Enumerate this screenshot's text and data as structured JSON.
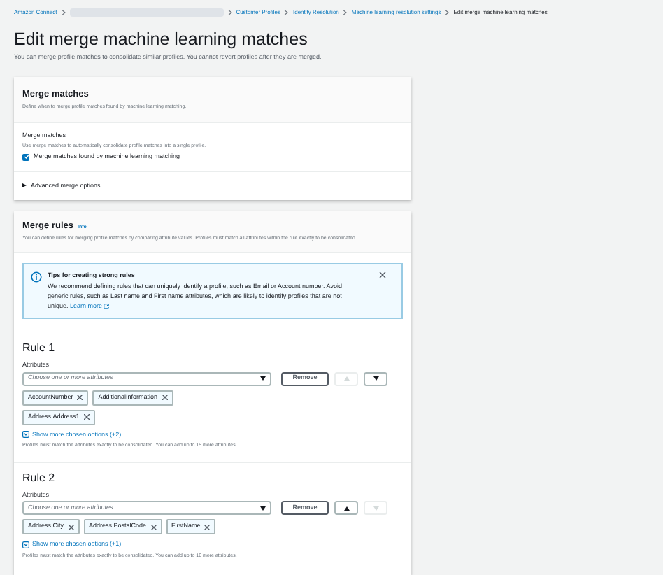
{
  "breadcrumbs": [
    {
      "label": "Amazon Connect",
      "current": false
    },
    {
      "kind": "redacted"
    },
    {
      "label": "Customer Profiles",
      "current": false
    },
    {
      "label": "Identity Resolution",
      "current": false
    },
    {
      "label": "Machine learning resolution settings",
      "current": false
    },
    {
      "label": "Edit merge machine learning matches",
      "current": true
    }
  ],
  "title": "Edit merge machine learning matches",
  "subtitle": "You can merge profile matches to consolidate similar profiles. You cannot revert profiles after they are merged.",
  "merge_matches": {
    "title": "Merge matches",
    "description": "Define when to merge profile matches found by machine learning matching.",
    "field_label": "Merge matches",
    "field_description": "Use merge matches to automatically consolidate profile matches into a single profile.",
    "checkbox": {
      "label": "Merge matches found by machine learning matching",
      "checked": true
    },
    "advanced": {
      "label": "Advanced merge options",
      "expanded": false
    }
  },
  "merge_rules": {
    "title": "Merge rules",
    "info": "Info",
    "description": "You can define rules for merging profile matches by comparing attribute values. Profiles must match all attributes within the rule exactly to be consolidated.",
    "alert": {
      "title": "Tips for creating strong rules",
      "text": "We recommend defining rules that can uniquely identify a profile, such as Email or Account number. Avoid generic rules, such as Last name and First name attributes, which are likely to identify profiles that are not unique.",
      "link": "Learn more"
    },
    "rules": [
      {
        "title": "Rule 1",
        "label": "Attributes",
        "placeholder": "Choose one or more attributes",
        "remove": "Remove",
        "up_disabled": true,
        "down_disabled": false,
        "tokens": [
          "AccountNumber",
          "AdditionalInformation",
          "Address.Address1"
        ],
        "show_more": "Show more chosen options (+2)",
        "hint": "Profiles must match the attributes exactly to be consolidated. You can add up to 15 more attributes."
      },
      {
        "title": "Rule 2",
        "label": "Attributes",
        "placeholder": "Choose one or more attributes",
        "remove": "Remove",
        "up_disabled": false,
        "down_disabled": true,
        "tokens": [
          "Address.City",
          "Address.PostalCode",
          "FirstName"
        ],
        "show_more": "Show more chosen options (+1)",
        "hint": "Profiles must match the attributes exactly to be consolidated. You can add up to 16 more attributes."
      }
    ]
  }
}
